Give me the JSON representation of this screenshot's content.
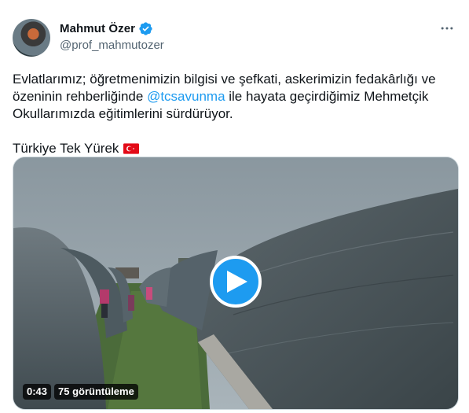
{
  "author": {
    "display_name": "Mahmut Özer",
    "handle": "@prof_mahmutozer",
    "verified": true
  },
  "tweet": {
    "text_part1": "Evlatlarımız; öğretmenimizin bilgisi ve şefkati, askerimizin fedakârlığı ve özeninin rehberliğinde ",
    "mention": "@tcsavunma",
    "text_part2": " ile hayata geçirdiğimiz Mehmetçik Okullarımızda eğitimlerini sürdürüyor.",
    "tagline": "Türkiye Tek Yürek"
  },
  "video": {
    "duration": "0:43",
    "views": "75 görüntüleme"
  },
  "colors": {
    "accent": "#1d9bf0",
    "text_primary": "#0f1419",
    "text_secondary": "#536471",
    "flag_red": "#e30a17"
  },
  "icons": {
    "verified": "verified-badge-icon",
    "more": "more-options-icon",
    "play": "play-icon",
    "flag": "turkey-flag-icon"
  }
}
